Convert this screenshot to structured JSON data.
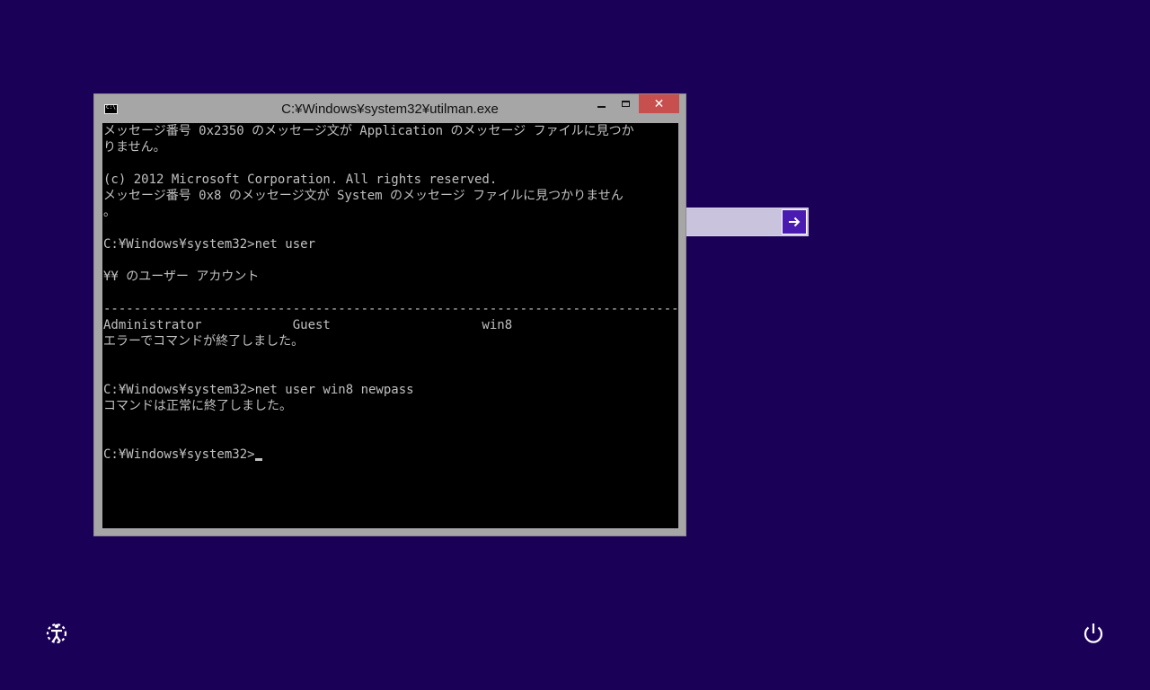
{
  "console": {
    "title": "C:¥Windows¥system32¥utilman.exe",
    "icon_label": "C:\\",
    "close_symbol": "✕",
    "lines": [
      "メッセージ番号 0x2350 のメッセージ文が Application のメッセージ ファイルに見つか",
      "りません。",
      "",
      "(c) 2012 Microsoft Corporation. All rights reserved.",
      "メッセージ番号 0x8 のメッセージ文が System のメッセージ ファイルに見つかりません",
      "。",
      "",
      "C:¥Windows¥system32>net user",
      "",
      "¥¥ のユーザー アカウント",
      "",
      "-------------------------------------------------------------------------------",
      "Administrator            Guest                    win8",
      "エラーでコマンドが終了しました。",
      "",
      "",
      "C:¥Windows¥system32>net user win8 newpass",
      "コマンドは正常に終了しました。",
      "",
      ""
    ],
    "prompt": "C:¥Windows¥system32>"
  },
  "login": {
    "password_value": "",
    "submit_icon": "arrow-right-icon"
  },
  "footer": {
    "ease_of_access_icon": "ease-of-access-icon",
    "power_icon": "power-icon"
  },
  "colors": {
    "background": "#1b0058",
    "accent": "#4a1bb0",
    "close_button": "#c7504f"
  }
}
